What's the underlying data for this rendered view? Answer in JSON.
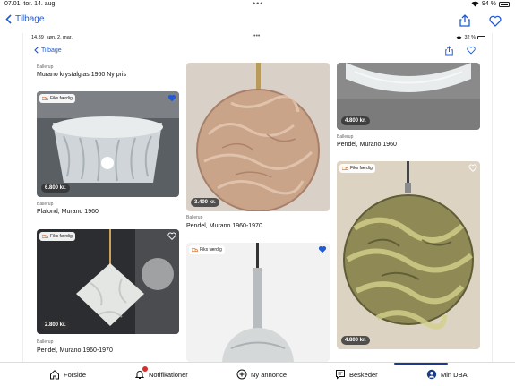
{
  "status": {
    "time": "07.01",
    "date": "tor. 14. aug.",
    "battery": "94 %"
  },
  "nav": {
    "back_label": "Tilbage"
  },
  "inner": {
    "status": {
      "time": "14.39",
      "date": "søn. 2. mar.",
      "battery": "32 %"
    },
    "back_label": "Tilbage"
  },
  "listings": [
    {
      "location": "Ballerup",
      "title": "Murano krystalglas 1960 Ny pris"
    },
    {
      "location": "",
      "title": "",
      "price": "4.800 kr."
    },
    {
      "location": "Ballerup",
      "title": "Plafond, Murano 1960",
      "price": "6.800 kr.",
      "badge": "Fiks færdig",
      "favorited": true
    },
    {
      "location": "Ballerup",
      "title": "Pendel, Murano 1960-1970",
      "price": "3.400 kr."
    },
    {
      "location": "Ballerup",
      "title": "Pendel, Murano 1960",
      "price": "4.800 kr."
    },
    {
      "location": "Ballerup",
      "title": "Pendel, Murano 1960-1970",
      "price": "2.800 kr.",
      "badge": "Fiks færdig",
      "favorited": false
    },
    {
      "location": "",
      "title": "",
      "badge": "Fiks færdig",
      "favorited": true
    },
    {
      "location": "",
      "title": "",
      "price": "4.800 kr.",
      "badge": "Fiks færdig",
      "favorited": false
    }
  ],
  "tabs": [
    {
      "label": "Forside",
      "icon": "home-icon"
    },
    {
      "label": "Notifikationer",
      "icon": "bell-icon",
      "has_badge": true
    },
    {
      "label": "Ny annonce",
      "icon": "plus-circle-icon"
    },
    {
      "label": "Beskeder",
      "icon": "chat-icon"
    },
    {
      "label": "Min DBA",
      "icon": "profile-icon",
      "active": true
    }
  ],
  "colors": {
    "accent": "#1f5bd6",
    "active_tab": "#1a3c8a",
    "badge": "#d32f2f"
  }
}
